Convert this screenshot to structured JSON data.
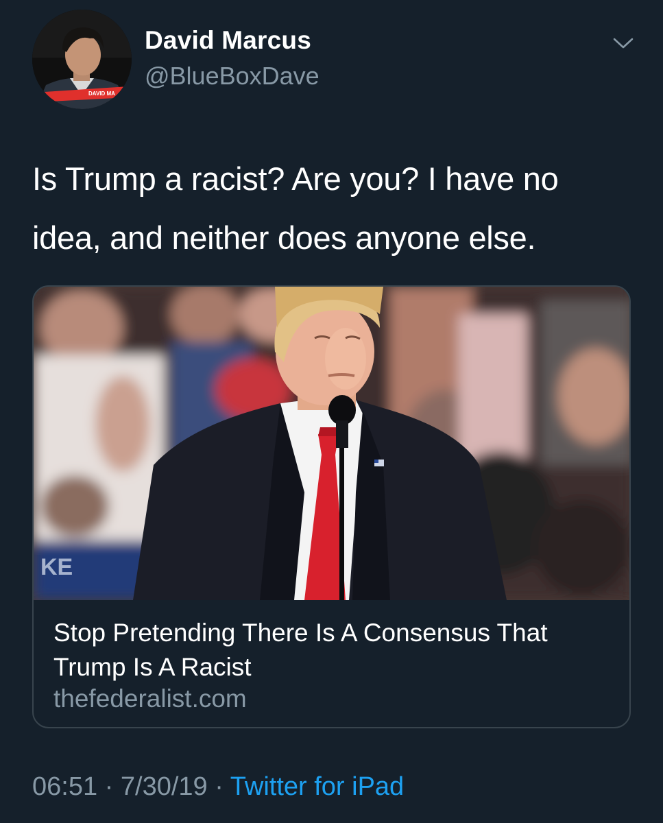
{
  "author": {
    "display_name": "David Marcus",
    "handle": "@BlueBoxDave",
    "avatar_caption": "DAVID MA"
  },
  "tweet": {
    "text": "Is Trump a racist? Are you? I have no idea, and neither does anyone else."
  },
  "card": {
    "title": "Stop Pretending There Is A Consensus That Trump Is A Racist",
    "domain": "thefederalist.com"
  },
  "meta": {
    "time": "06:51",
    "separator": "·",
    "date": "7/30/19",
    "source": "Twitter for iPad"
  },
  "icons": {
    "menu": "chevron-down-icon"
  },
  "colors": {
    "background": "#15202b",
    "secondary_text": "#8899a6",
    "link": "#1da1f2",
    "card_border": "#38444d"
  }
}
